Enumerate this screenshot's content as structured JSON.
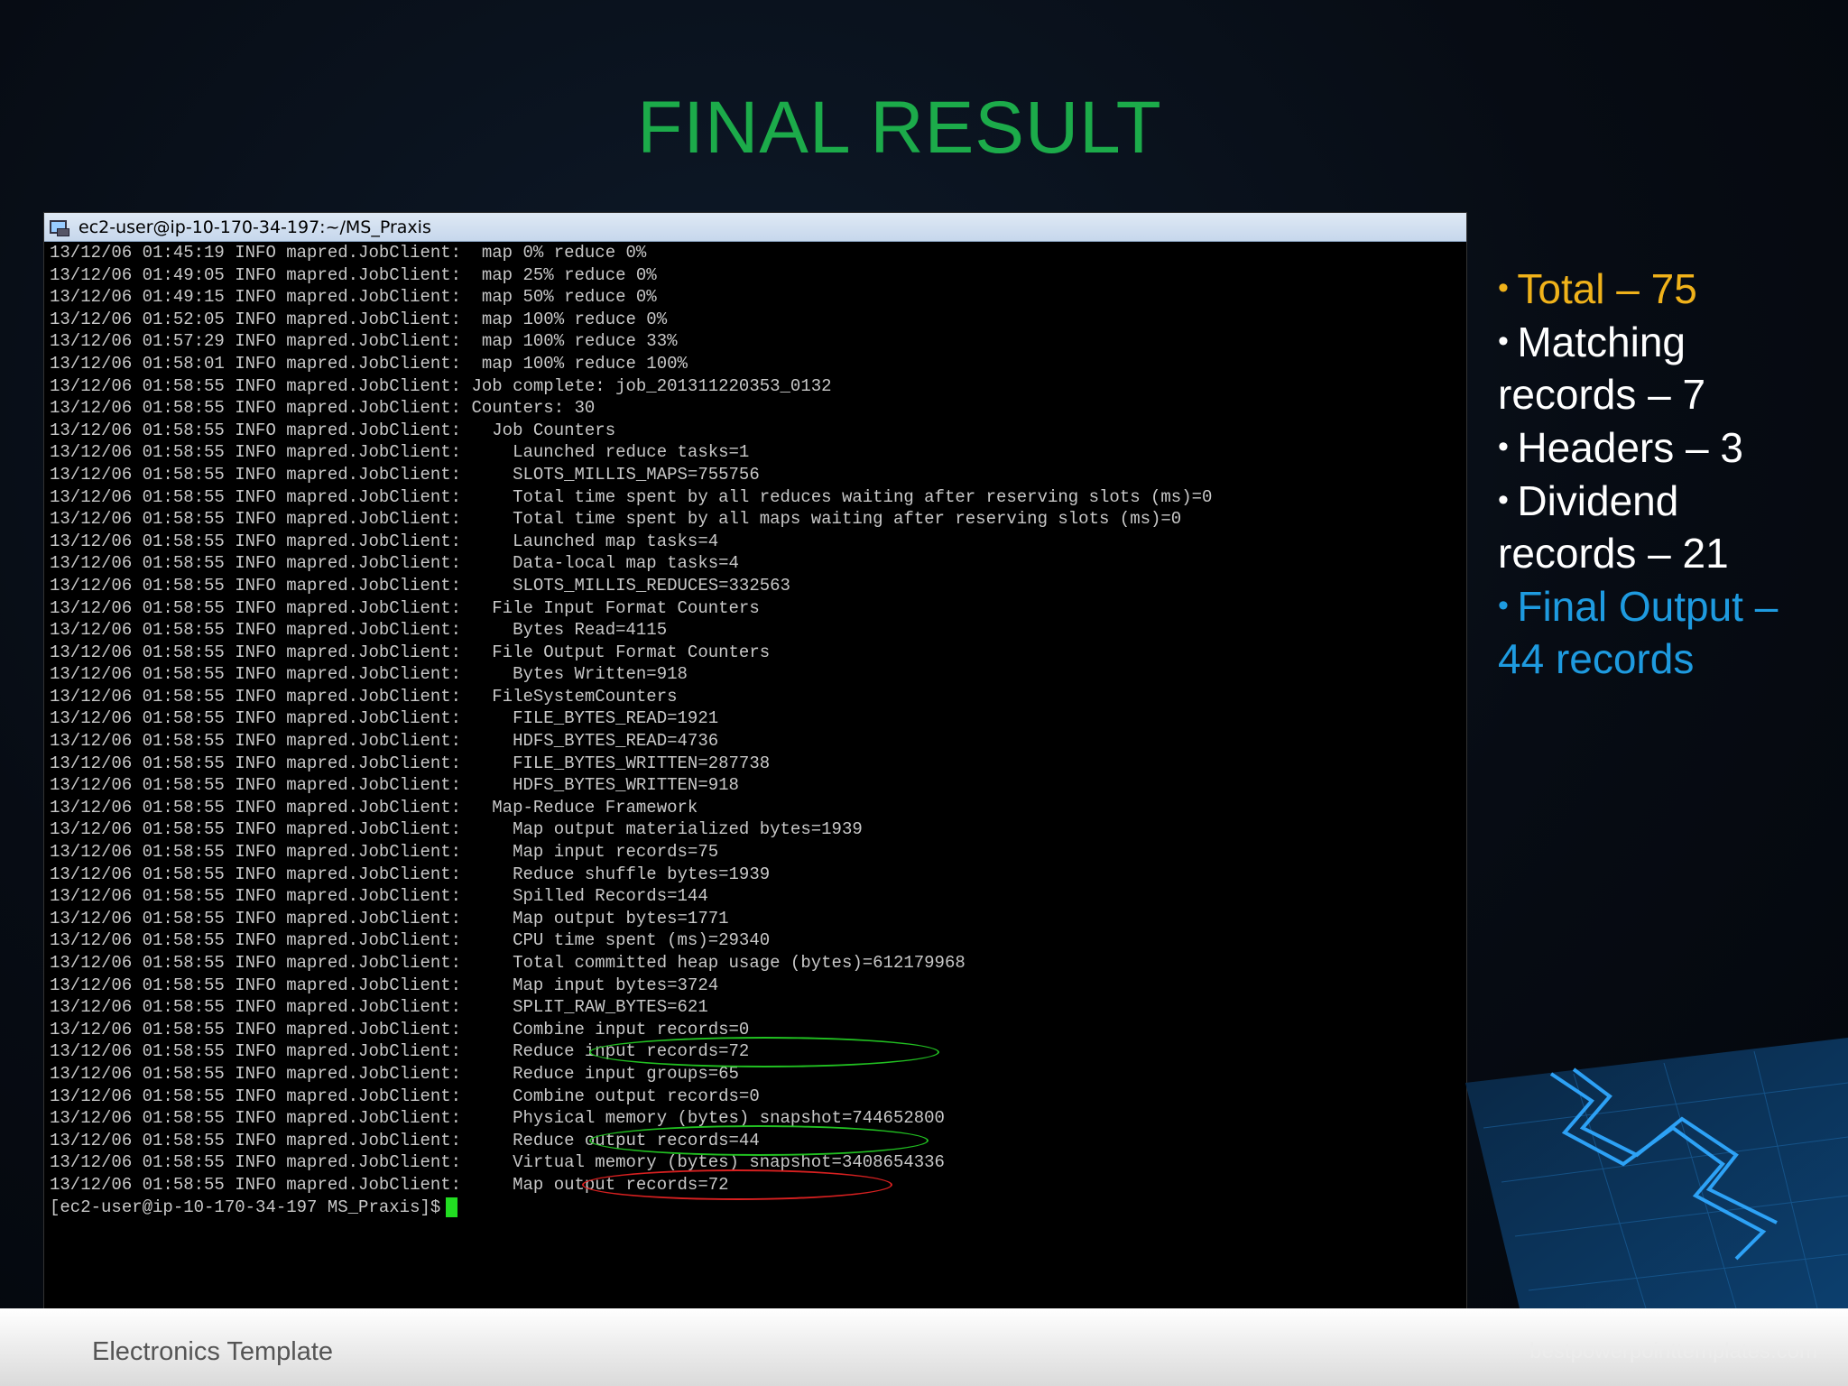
{
  "slide": {
    "title": "FINAL RESULT",
    "footer_text": "Electronics Template",
    "footer_url": "bestpowerpointtemplates.com"
  },
  "terminal": {
    "window_title": "ec2-user@ip-10-170-34-197:~/MS_Praxis",
    "lines": [
      "13/12/06 01:45:19 INFO mapred.JobClient:  map 0% reduce 0%",
      "13/12/06 01:49:05 INFO mapred.JobClient:  map 25% reduce 0%",
      "13/12/06 01:49:15 INFO mapred.JobClient:  map 50% reduce 0%",
      "13/12/06 01:52:05 INFO mapred.JobClient:  map 100% reduce 0%",
      "13/12/06 01:57:29 INFO mapred.JobClient:  map 100% reduce 33%",
      "13/12/06 01:58:01 INFO mapred.JobClient:  map 100% reduce 100%",
      "13/12/06 01:58:55 INFO mapred.JobClient: Job complete: job_201311220353_0132",
      "13/12/06 01:58:55 INFO mapred.JobClient: Counters: 30",
      "13/12/06 01:58:55 INFO mapred.JobClient:   Job Counters",
      "13/12/06 01:58:55 INFO mapred.JobClient:     Launched reduce tasks=1",
      "13/12/06 01:58:55 INFO mapred.JobClient:     SLOTS_MILLIS_MAPS=755756",
      "13/12/06 01:58:55 INFO mapred.JobClient:     Total time spent by all reduces waiting after reserving slots (ms)=0",
      "13/12/06 01:58:55 INFO mapred.JobClient:     Total time spent by all maps waiting after reserving slots (ms)=0",
      "13/12/06 01:58:55 INFO mapred.JobClient:     Launched map tasks=4",
      "13/12/06 01:58:55 INFO mapred.JobClient:     Data-local map tasks=4",
      "13/12/06 01:58:55 INFO mapred.JobClient:     SLOTS_MILLIS_REDUCES=332563",
      "13/12/06 01:58:55 INFO mapred.JobClient:   File Input Format Counters",
      "13/12/06 01:58:55 INFO mapred.JobClient:     Bytes Read=4115",
      "13/12/06 01:58:55 INFO mapred.JobClient:   File Output Format Counters",
      "13/12/06 01:58:55 INFO mapred.JobClient:     Bytes Written=918",
      "13/12/06 01:58:55 INFO mapred.JobClient:   FileSystemCounters",
      "13/12/06 01:58:55 INFO mapred.JobClient:     FILE_BYTES_READ=1921",
      "13/12/06 01:58:55 INFO mapred.JobClient:     HDFS_BYTES_READ=4736",
      "13/12/06 01:58:55 INFO mapred.JobClient:     FILE_BYTES_WRITTEN=287738",
      "13/12/06 01:58:55 INFO mapred.JobClient:     HDFS_BYTES_WRITTEN=918",
      "13/12/06 01:58:55 INFO mapred.JobClient:   Map-Reduce Framework",
      "13/12/06 01:58:55 INFO mapred.JobClient:     Map output materialized bytes=1939",
      "13/12/06 01:58:55 INFO mapred.JobClient:     Map input records=75",
      "13/12/06 01:58:55 INFO mapred.JobClient:     Reduce shuffle bytes=1939",
      "13/12/06 01:58:55 INFO mapred.JobClient:     Spilled Records=144",
      "13/12/06 01:58:55 INFO mapred.JobClient:     Map output bytes=1771",
      "13/12/06 01:58:55 INFO mapred.JobClient:     CPU time spent (ms)=29340",
      "13/12/06 01:58:55 INFO mapred.JobClient:     Total committed heap usage (bytes)=612179968",
      "13/12/06 01:58:55 INFO mapred.JobClient:     Map input bytes=3724",
      "13/12/06 01:58:55 INFO mapred.JobClient:     SPLIT_RAW_BYTES=621",
      "13/12/06 01:58:55 INFO mapred.JobClient:     Combine input records=0",
      "13/12/06 01:58:55 INFO mapred.JobClient:     Reduce input records=72",
      "13/12/06 01:58:55 INFO mapred.JobClient:     Reduce input groups=65",
      "13/12/06 01:58:55 INFO mapred.JobClient:     Combine output records=0",
      "13/12/06 01:58:55 INFO mapred.JobClient:     Physical memory (bytes) snapshot=744652800",
      "13/12/06 01:58:55 INFO mapred.JobClient:     Reduce output records=44",
      "13/12/06 01:58:55 INFO mapred.JobClient:     Virtual memory (bytes) snapshot=3408654336",
      "13/12/06 01:58:55 INFO mapred.JobClient:     Map output records=72"
    ],
    "prompt": "[ec2-user@ip-10-170-34-197 MS_Praxis]$",
    "highlight_colors": {
      "green": "#21c021",
      "red": "#d72020"
    }
  },
  "bullets": [
    {
      "text": "Total – 75",
      "color": "#f0b21a"
    },
    {
      "text": "Matching records – 7",
      "color": "#ffffff"
    },
    {
      "text": "Headers – 3",
      "color": "#ffffff"
    },
    {
      "text": "Dividend records – 21",
      "color": "#ffffff"
    },
    {
      "text": "Final Output – 44 records",
      "color": "#1e9be0"
    }
  ]
}
